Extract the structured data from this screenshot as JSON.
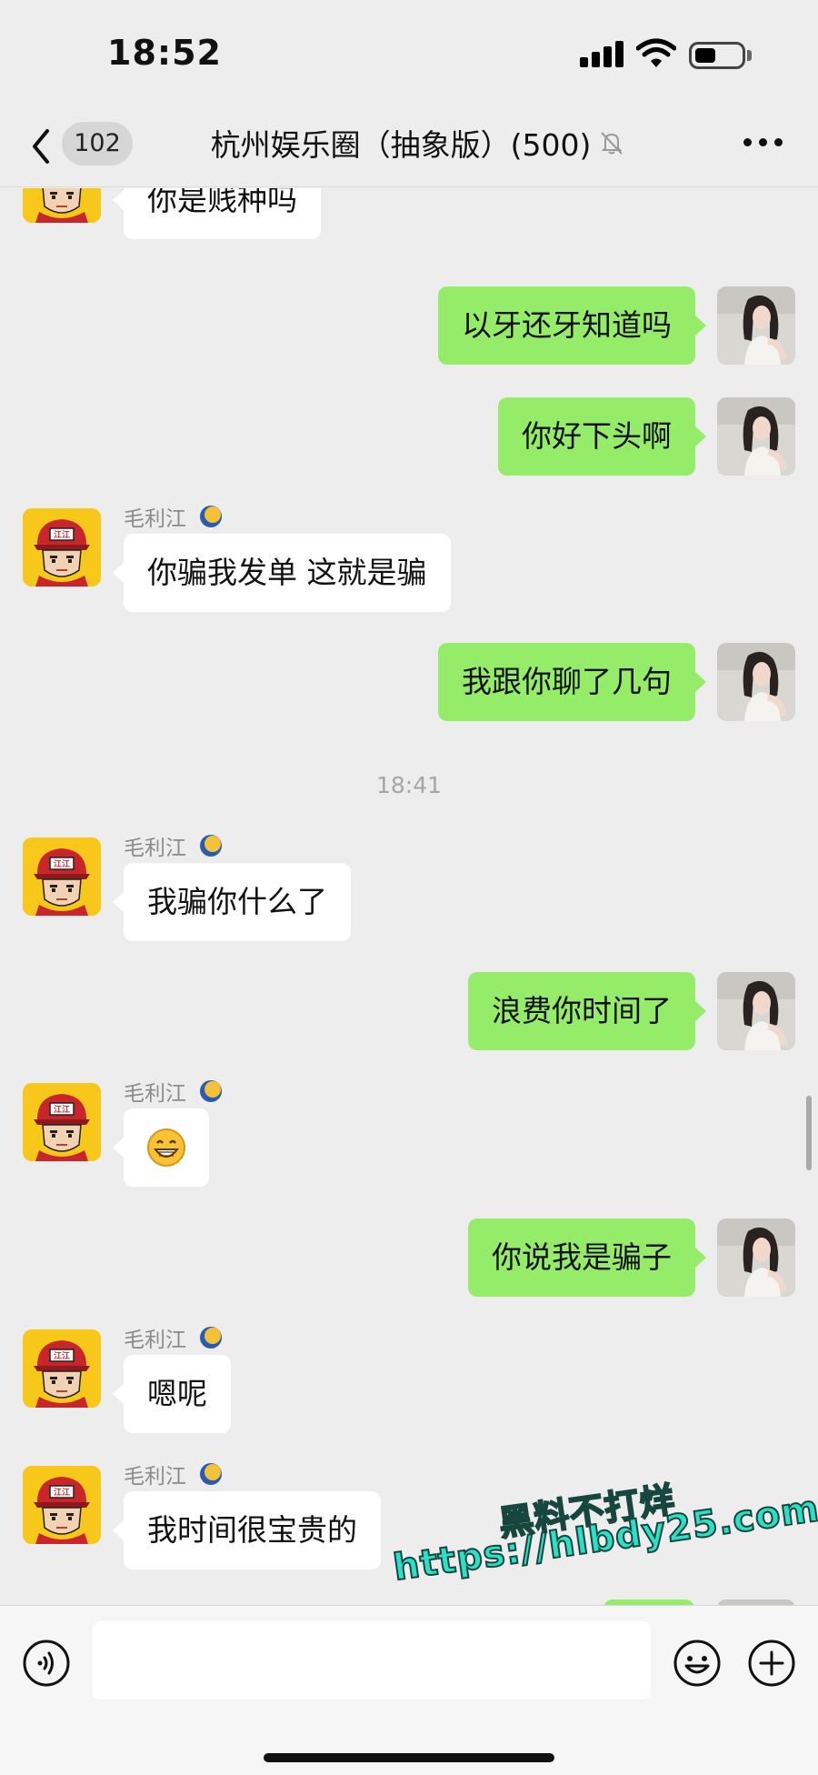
{
  "status_bar": {
    "time": "18:52",
    "icons": [
      "signal-icon",
      "wifi-icon",
      "battery-icon"
    ]
  },
  "header": {
    "back_icon": "chevron-left-icon",
    "unread_count": "102",
    "title": "杭州娱乐圈（抽象版）(500)",
    "mute_icon": "bell-off-icon",
    "more_icon": "more-dots-icon"
  },
  "messages": [
    {
      "side": "left",
      "sender": "",
      "text": "你是贱种吗"
    },
    {
      "side": "right",
      "text": "以牙还牙知道吗"
    },
    {
      "side": "right",
      "text": "你好下头啊"
    },
    {
      "side": "left",
      "sender": "毛利江",
      "text": "你骗我发单 这就是骗"
    },
    {
      "side": "right",
      "text": "我跟你聊了几句"
    },
    {
      "type": "time",
      "text": "18:41"
    },
    {
      "side": "left",
      "sender": "毛利江",
      "text": "我骗你什么了"
    },
    {
      "side": "right",
      "text": "浪费你时间了"
    },
    {
      "side": "left",
      "sender": "毛利江",
      "text": "😁",
      "emoji_icon": "grin-emoji-icon"
    },
    {
      "side": "right",
      "text": "你说我是骗子"
    },
    {
      "side": "left",
      "sender": "毛利江",
      "text": "嗯呢"
    },
    {
      "side": "left",
      "sender": "毛利江",
      "text": "我时间很宝贵的"
    }
  ],
  "watermark": {
    "line1": "黑料不打烊",
    "line2": "https://hlbdy25.com"
  },
  "input_bar": {
    "voice_icon": "voice-icon",
    "message_value": "",
    "emoji_icon": "smiley-icon",
    "plus_icon": "plus-circle-icon"
  },
  "colors": {
    "background": "#ededed",
    "bubble_outgoing": "#95ec69",
    "bubble_incoming": "#ffffff",
    "watermark": "#2ce0c8"
  }
}
